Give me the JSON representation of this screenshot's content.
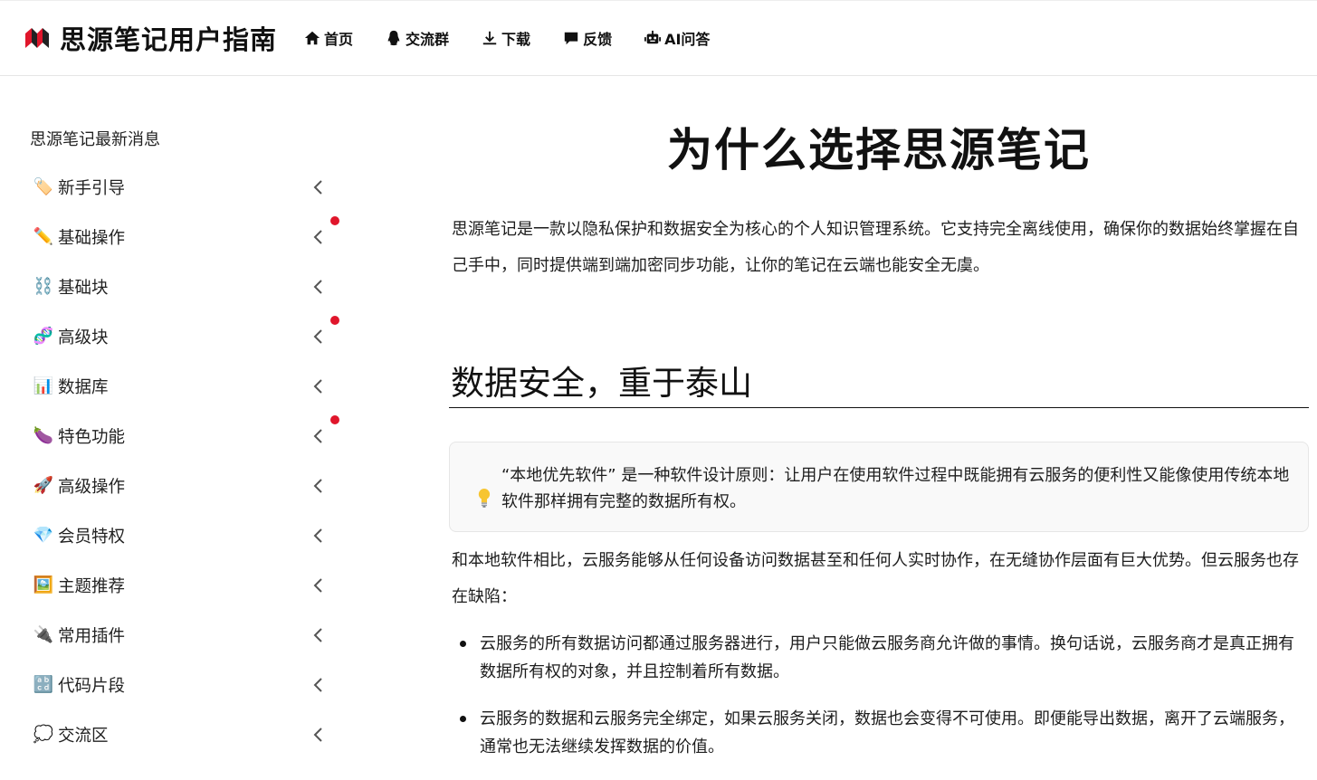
{
  "header": {
    "site_title": "思源笔记用户指南",
    "nav": [
      {
        "icon": "home-icon",
        "label": "首页"
      },
      {
        "icon": "qq-icon",
        "label": "交流群"
      },
      {
        "icon": "download-icon",
        "label": "下载"
      },
      {
        "icon": "feedback-icon",
        "label": "反馈"
      },
      {
        "icon": "robot-icon",
        "label": "AI问答"
      }
    ]
  },
  "sidebar": {
    "news": "思源笔记最新消息",
    "items": [
      {
        "emoji": "🏷️",
        "label": "新手引导",
        "new": false
      },
      {
        "emoji": "✏️",
        "label": "基础操作",
        "new": true
      },
      {
        "emoji": "⛓️",
        "label": "基础块",
        "new": false
      },
      {
        "emoji": "🧬",
        "label": "高级块",
        "new": true
      },
      {
        "emoji": "📊",
        "label": "数据库",
        "new": false
      },
      {
        "emoji": "🍆",
        "label": "特色功能",
        "new": true
      },
      {
        "emoji": "🚀",
        "label": "高级操作",
        "new": false
      },
      {
        "emoji": "💎",
        "label": "会员特权",
        "new": false
      },
      {
        "emoji": "🖼️",
        "label": "主题推荐",
        "new": false
      },
      {
        "emoji": "🔌",
        "label": "常用插件",
        "new": false
      },
      {
        "emoji": "🔡",
        "label": "代码片段",
        "new": false
      },
      {
        "emoji": "💭",
        "label": "交流区",
        "new": false
      }
    ]
  },
  "main": {
    "title": "为什么选择思源笔记",
    "intro": "思源笔记是一款以隐私保护和数据安全为核心的个人知识管理系统。它支持完全离线使用，确保你的数据始终掌握在自己手中，同时提供端到端加密同步功能，让你的笔记在云端也能安全无虞。",
    "section_title": "数据安全，重于泰山",
    "tip": "“本地优先软件” 是一种软件设计原则：让用户在使用软件过程中既能拥有云服务的便利性又能像使用传统本地软件那样拥有完整的数据所有权。",
    "compare": "和本地软件相比，云服务能够从任何设备访问数据甚至和任何人实时协作，在无缝协作层面有巨大优势。但云服务也存在缺陷：",
    "bullets": [
      "云服务的所有数据访问都通过服务器进行，用户只能做云服务商允许做的事情。换句话说，云服务商才是真正拥有数据所有权的对象，并且控制着所有数据。",
      "云服务的数据和云服务完全绑定，如果云服务关闭，数据也会变得不可使用。即便能导出数据，离开了云端服务，通常也无法继续发挥数据的价值。"
    ]
  }
}
